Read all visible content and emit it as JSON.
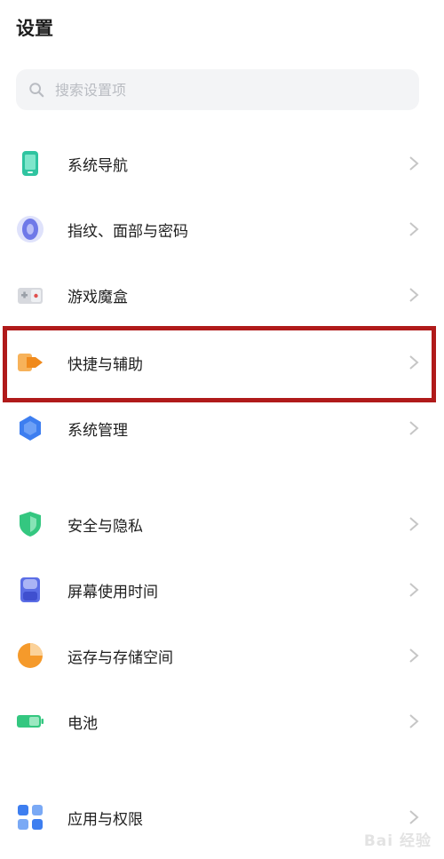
{
  "header": {
    "title": "设置"
  },
  "search": {
    "placeholder": "搜索设置项"
  },
  "items": [
    {
      "label": "系统导航",
      "icon": "phone-icon"
    },
    {
      "label": "指纹、面部与密码",
      "icon": "fingerprint-icon"
    },
    {
      "label": "游戏魔盒",
      "icon": "game-box-icon"
    },
    {
      "label": "快捷与辅助",
      "icon": "shortcut-arrow-icon"
    },
    {
      "label": "系统管理",
      "icon": "hexagon-icon"
    },
    {
      "label": "安全与隐私",
      "icon": "shield-icon"
    },
    {
      "label": "屏幕使用时间",
      "icon": "hourglass-icon"
    },
    {
      "label": "运存与存储空间",
      "icon": "pie-chart-icon"
    },
    {
      "label": "电池",
      "icon": "battery-icon"
    },
    {
      "label": "应用与权限",
      "icon": "apps-grid-icon"
    }
  ],
  "watermark": {
    "text": "Bai 经验"
  },
  "colors": {
    "highlight": "#b01a1a",
    "accent_blue": "#3d7ef0",
    "orange": "#f59a2b",
    "green": "#34c780"
  }
}
